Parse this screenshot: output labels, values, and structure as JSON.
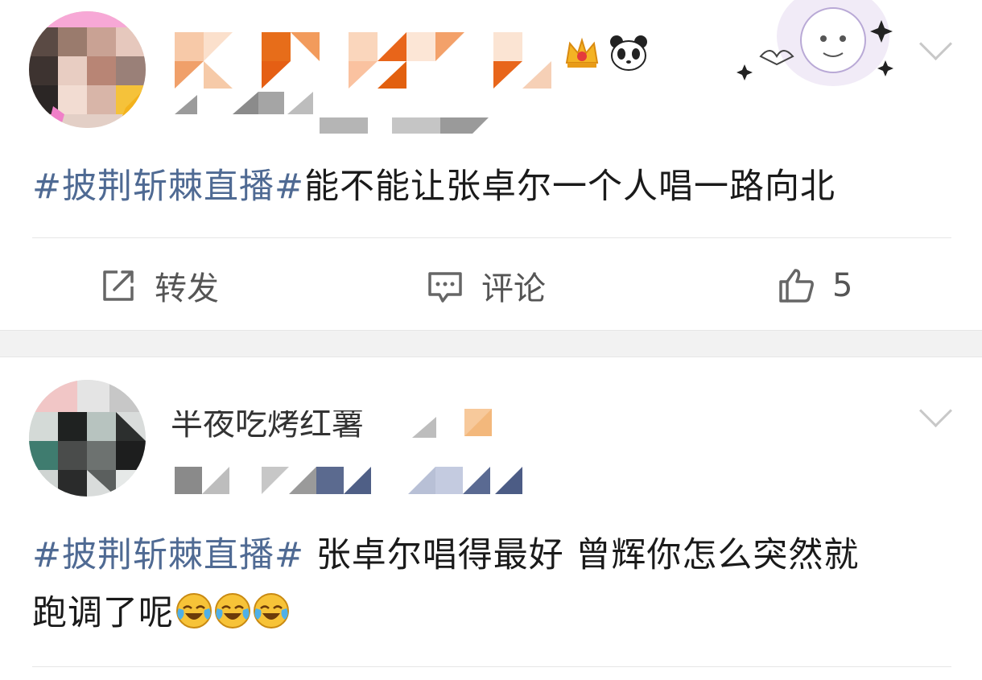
{
  "posts": [
    {
      "user": {
        "name_hidden": true,
        "meta_hidden": true
      },
      "hashtag": "#披荆斩棘直播#",
      "text": "能不能让张卓尔一个人唱一路向北",
      "actions": {
        "repost_label": "转发",
        "comment_label": "评论",
        "like_count": "5"
      }
    },
    {
      "user": {
        "name_visible_part": "半夜吃烤红薯",
        "meta_hidden": true
      },
      "hashtag": "#披荆斩棘直播#",
      "text_line1": " 张卓尔唱得最好 曾辉你怎么突然就",
      "text_line2": "跑调了呢",
      "emojis": [
        "crying-laughing-emoji",
        "crying-laughing-emoji",
        "crying-laughing-emoji"
      ]
    }
  ],
  "colors": {
    "hashtag": "#4f6a93",
    "separator": "#f2f2f2",
    "icon": "#555555"
  }
}
